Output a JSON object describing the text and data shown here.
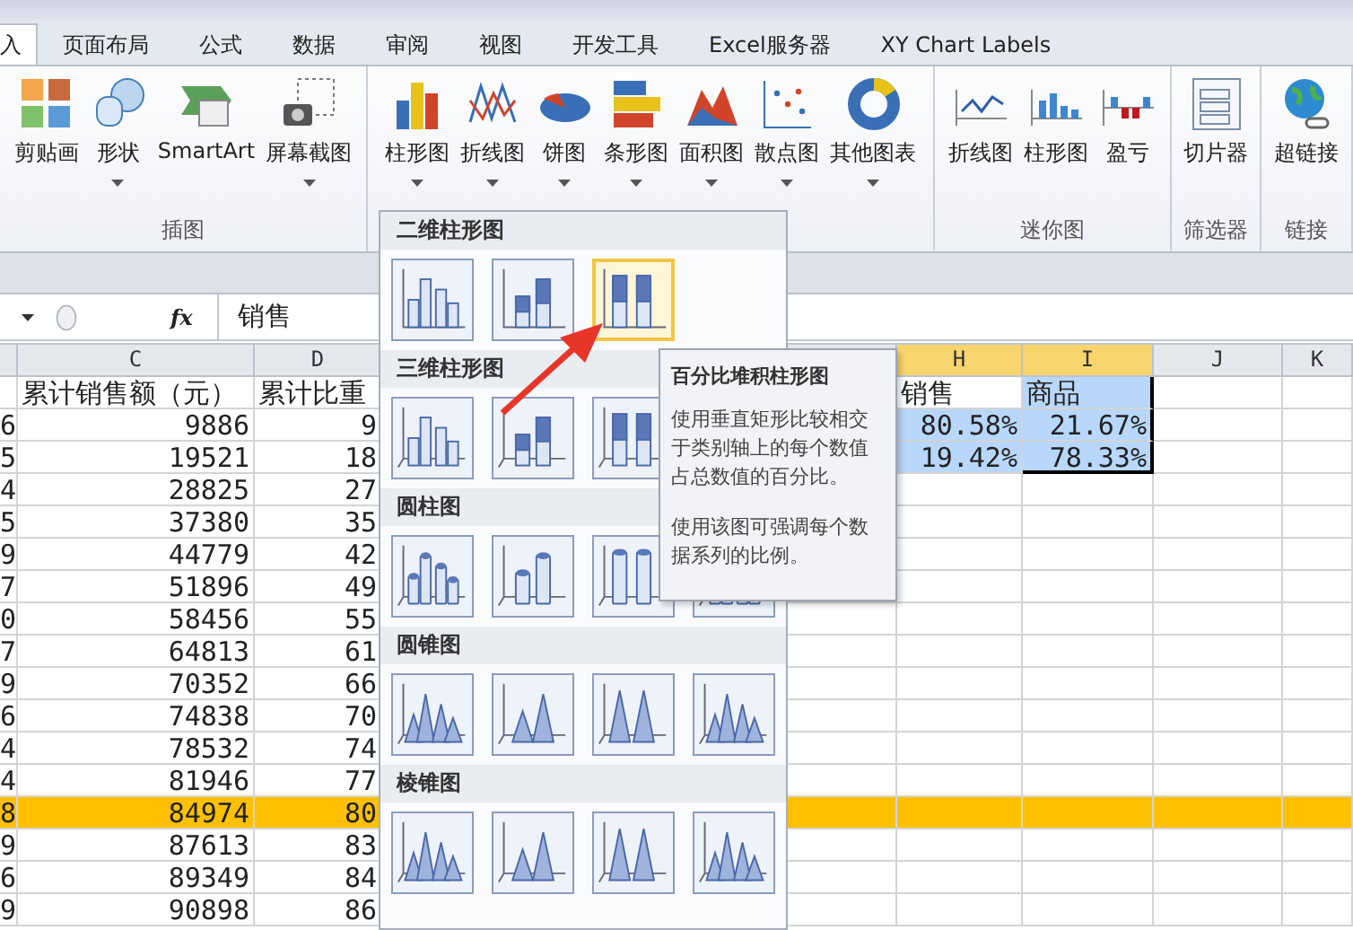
{
  "tabs": [
    {
      "label": "入",
      "selected": true
    },
    {
      "label": "页面布局",
      "selected": false
    },
    {
      "label": "公式",
      "selected": false
    },
    {
      "label": "数据",
      "selected": false
    },
    {
      "label": "审阅",
      "selected": false
    },
    {
      "label": "视图",
      "selected": false
    },
    {
      "label": "开发工具",
      "selected": false
    },
    {
      "label": "Excel服务器",
      "selected": false
    },
    {
      "label": "XY Chart Labels",
      "selected": false
    }
  ],
  "ribbon_groups": [
    {
      "label": "插图",
      "items": [
        {
          "label": "剪贴画",
          "dropdown": false
        },
        {
          "label": "形状",
          "dropdown": true
        },
        {
          "label": "SmartArt",
          "dropdown": false
        },
        {
          "label": "屏幕截图",
          "dropdown": true
        }
      ]
    },
    {
      "items": [
        {
          "label": "柱形图",
          "dropdown": true
        },
        {
          "label": "折线图",
          "dropdown": true
        },
        {
          "label": "饼图",
          "dropdown": true
        },
        {
          "label": "条形图",
          "dropdown": true
        },
        {
          "label": "面积图",
          "dropdown": true
        },
        {
          "label": "散点图",
          "dropdown": true
        },
        {
          "label": "其他图表",
          "dropdown": true
        }
      ]
    },
    {
      "label": "迷你图",
      "items": [
        {
          "label": "折线图",
          "dropdown": false
        },
        {
          "label": "柱形图",
          "dropdown": false
        },
        {
          "label": "盈亏",
          "dropdown": false
        }
      ]
    },
    {
      "label": "筛选器",
      "items": [
        {
          "label": "切片器",
          "dropdown": false
        }
      ]
    },
    {
      "label": "链接",
      "items": [
        {
          "label": "超链接",
          "dropdown": false
        }
      ]
    }
  ],
  "formula_bar": {
    "function_label": "fx",
    "value": "销售"
  },
  "columns": [
    {
      "label": "C",
      "selected": false
    },
    {
      "label": "D",
      "selected": false
    },
    {
      "label": "H",
      "selected": true
    },
    {
      "label": "I",
      "selected": true
    },
    {
      "label": "J",
      "selected": false
    },
    {
      "label": "K",
      "selected": false
    }
  ],
  "rows": [
    {
      "c": "累计销售额（元）",
      "d": "累计比重",
      "h": "销售",
      "i": "商品",
      "selected": true,
      "highlighted": false
    },
    {
      "b": "6",
      "c": "9886",
      "d": "9",
      "h": "80.58%",
      "i": "21.67%",
      "selected": true,
      "highlighted": false
    },
    {
      "b": "5",
      "c": "19521",
      "d": "18",
      "h": "19.42%",
      "i": "78.33%",
      "selected": true,
      "highlighted": false
    },
    {
      "b": "4",
      "c": "28825",
      "d": "27",
      "selected": false,
      "highlighted": false
    },
    {
      "b": "5",
      "c": "37380",
      "d": "35",
      "selected": false,
      "highlighted": false
    },
    {
      "b": "9",
      "c": "44779",
      "d": "42",
      "selected": false,
      "highlighted": false
    },
    {
      "b": "7",
      "c": "51896",
      "d": "49",
      "selected": false,
      "highlighted": false
    },
    {
      "b": "0",
      "c": "58456",
      "d": "55",
      "selected": false,
      "highlighted": false
    },
    {
      "b": "7",
      "c": "64813",
      "d": "61",
      "selected": false,
      "highlighted": false
    },
    {
      "b": "9",
      "c": "70352",
      "d": "66",
      "selected": false,
      "highlighted": false
    },
    {
      "b": "6",
      "c": "74838",
      "d": "70",
      "selected": false,
      "highlighted": false
    },
    {
      "b": "4",
      "c": "78532",
      "d": "74",
      "selected": false,
      "highlighted": false
    },
    {
      "b": "4",
      "c": "81946",
      "d": "77",
      "selected": false,
      "highlighted": false
    },
    {
      "b": "8",
      "c": "84974",
      "d": "80",
      "selected": false,
      "highlighted": true
    },
    {
      "b": "9",
      "c": "87613",
      "d": "83",
      "selected": false,
      "highlighted": false
    },
    {
      "b": "6",
      "c": "89349",
      "d": "84",
      "selected": false,
      "highlighted": false
    },
    {
      "b": "9",
      "c": "90898",
      "d": "86",
      "selected": false,
      "highlighted": false
    }
  ],
  "gallery": {
    "sections": [
      {
        "title": "二维柱形图",
        "kind": "flat",
        "thumbs": [
          {
            "selected": false
          },
          {
            "selected": false
          },
          {
            "selected": true
          }
        ]
      },
      {
        "title": "三维柱形图",
        "kind": "box",
        "thumbs": [
          {
            "selected": false
          },
          {
            "selected": false
          },
          {
            "selected": false
          }
        ]
      },
      {
        "title": "圆柱图",
        "kind": "cylinder",
        "thumbs": [
          {
            "selected": false
          },
          {
            "selected": false
          },
          {
            "selected": false
          },
          {
            "selected": false
          }
        ]
      },
      {
        "title": "圆锥图",
        "kind": "cone",
        "thumbs": [
          {
            "selected": false
          },
          {
            "selected": false
          },
          {
            "selected": false
          },
          {
            "selected": false
          }
        ]
      },
      {
        "title": "棱锥图",
        "kind": "pyramid",
        "thumbs": [
          {
            "selected": false
          },
          {
            "selected": false
          },
          {
            "selected": false
          },
          {
            "selected": false
          }
        ]
      }
    ]
  },
  "tooltip": {
    "title": "百分比堆积柱形图",
    "paragraphs": [
      "使用垂直矩形比较相交于类别轴上的每个数值占总数值的百分比。",
      "使用该图可强调每个数据系列的比例。"
    ]
  }
}
